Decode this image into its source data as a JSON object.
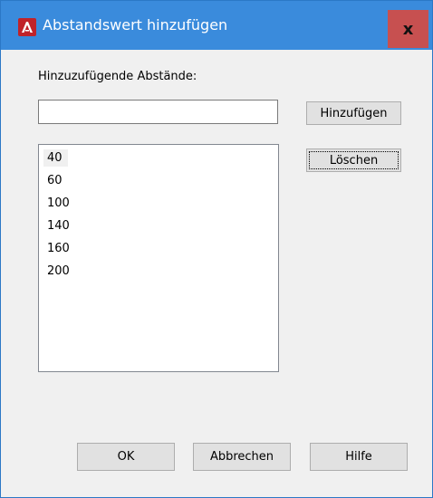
{
  "window": {
    "title": "Abstandswert hinzufügen",
    "close_label": "x",
    "app_icon": "autocad-logo-icon",
    "title_bar_color": "#3a8bdc",
    "close_color": "#c75050"
  },
  "form": {
    "label": "Hinzuzufügende Abstände:",
    "input_value": "",
    "add_button": "Hinzufügen",
    "delete_button": "Löschen"
  },
  "list": {
    "items": [
      "40",
      "60",
      "100",
      "140",
      "160",
      "200"
    ]
  },
  "footer": {
    "ok": "OK",
    "cancel": "Abbrechen",
    "help": "Hilfe"
  }
}
